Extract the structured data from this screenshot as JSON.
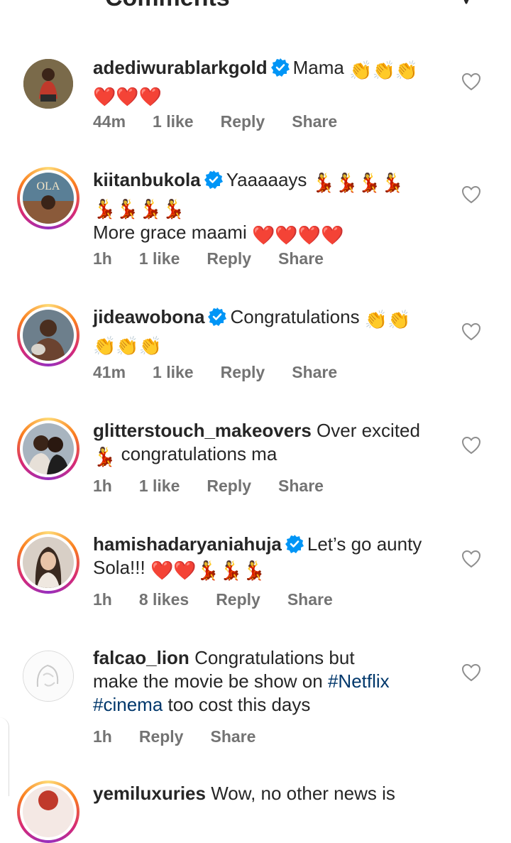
{
  "header": {
    "title": "Comments"
  },
  "comments": [
    {
      "username": "adediwurablarkgold",
      "verified": true,
      "text": "Mama",
      "emojis_line1": "👏👏👏",
      "emojis_line2": "❤️❤️❤️",
      "time": "44m",
      "likes": "1 like",
      "reply": "Reply",
      "share": "Share"
    },
    {
      "username": "kiitanbukola",
      "verified": true,
      "text": "Yaaaaays",
      "emojis_line1": "💃💃💃💃",
      "emojis_line2": "💃💃💃💃",
      "text2": "More grace maami",
      "emojis_line3": "❤️❤️❤️❤️",
      "avatar_text": "OLA",
      "time": "1h",
      "likes": "1 like",
      "reply": "Reply",
      "share": "Share"
    },
    {
      "username": "jideawobona",
      "verified": true,
      "text": "Congratulations",
      "emojis_line1": "👏👏",
      "emojis_line2": "👏👏👏",
      "time": "41m",
      "likes": "1 like",
      "reply": "Reply",
      "share": "Share"
    },
    {
      "username": "glitterstouch_makeovers",
      "verified": false,
      "text": "Over excited",
      "emojis_line2": "💃",
      "text2": "congratulations ma",
      "time": "1h",
      "likes": "1 like",
      "reply": "Reply",
      "share": "Share"
    },
    {
      "username": "hamishadaryaniahuja",
      "verified": true,
      "text": "Let’s go aunty",
      "text2": "Sola!!!",
      "emojis_line2": "❤️❤️💃💃💃",
      "time": "1h",
      "likes": "8 likes",
      "reply": "Reply",
      "share": "Share"
    },
    {
      "username": "falcao_lion",
      "verified": false,
      "text": "Congratulations but",
      "text2": "make the movie be show on",
      "hashtag1": "#Netflix",
      "hashtag2": "#cinema",
      "text3": "too cost this days",
      "time": "1h",
      "reply": "Reply",
      "share": "Share"
    },
    {
      "username": "yemiluxuries",
      "text": "Wow, no other news is"
    }
  ],
  "colors": {
    "accent_blue": "#0095f6",
    "hashtag": "#00376b",
    "meta_gray": "#737373"
  }
}
